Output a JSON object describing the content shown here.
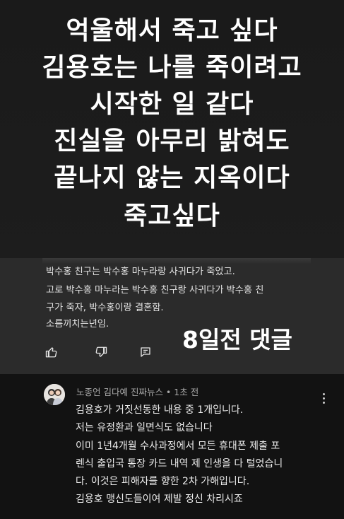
{
  "headline": {
    "lines": [
      "억울해서 죽고 싶다",
      "김용호는 나를 죽이려고",
      "시작한 일 같다",
      "진실을 아무리 밝혀도",
      "끝나지 않는 지옥이다",
      "죽고싶다"
    ]
  },
  "comment1": {
    "lines": [
      "박수홍 친구는 박수홍 마누라랑  사귀다가 죽었고.",
      "고로 박수홍 마누라는 박수홍 친구랑 사귀다가 박수홍 친",
      "구가 죽자, 박수홍이랑 결혼함.",
      "소름끼치는년임."
    ],
    "days_ago_label": "8일전 댓글",
    "like_icon": "thumbs-up-icon",
    "dislike_icon": "thumbs-down-icon",
    "reply_icon": "reply-comment-icon"
  },
  "comment2": {
    "author_line": "노종언 김다예 진짜뉴스 • 1초 전",
    "avatar_icon": "avatar",
    "menu_icon": "more-vert-icon",
    "lines": [
      "김용호가 거짓선동한 내용 중 1개입니다.",
      "저는 유정환과 일면식도 없습니다",
      "이미 1년4개월 수사과정에서 모든 휴대폰 제출 포",
      "렌식 출입국 통장 카드 내역 제 인생을 다 털었습니",
      "다. 이것은 피해자를 향한 2차 가해입니다.",
      "김용호 맹신도들이여 제발 정신 차리시죠"
    ]
  },
  "colors": {
    "headline_bg": "#1b1b1b",
    "comment1_bg": "#2b2b2b",
    "comment2_bg": "#121212",
    "text": "#ffffff"
  }
}
